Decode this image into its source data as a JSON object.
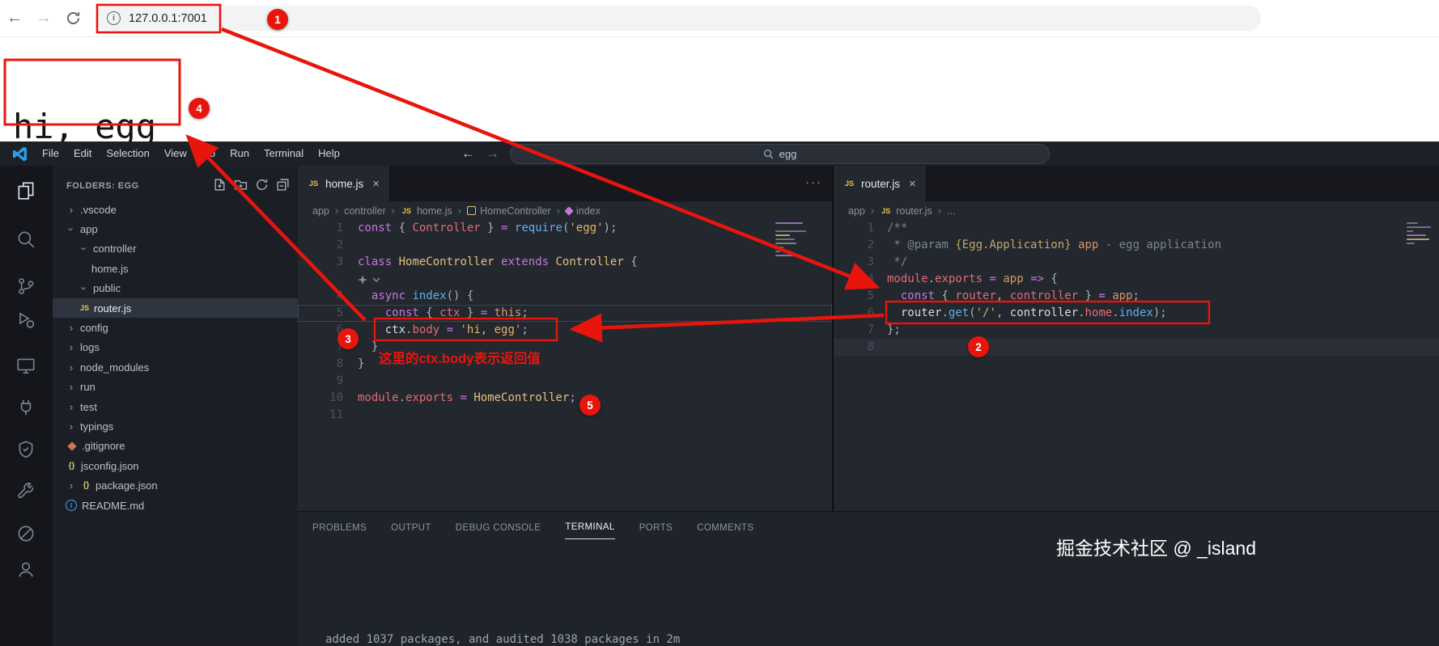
{
  "browser": {
    "url": "127.0.0.1:7001",
    "page_text": "hi, egg"
  },
  "icons": {
    "js_badge": "JS",
    "braces_badge": "{}"
  },
  "colors": {
    "annotation_red": "#e8150d",
    "js_icon_yellow": "#e3c74c",
    "info_blue": "#4aa0e8"
  },
  "vscode": {
    "title_menus": [
      "File",
      "Edit",
      "Selection",
      "View",
      "Go",
      "Run",
      "Terminal",
      "Help"
    ],
    "command_center": {
      "value": "egg"
    },
    "activity_icons": [
      "explorer",
      "search",
      "source-control",
      "run-debug",
      "remote-explorer",
      "ports",
      "shield",
      "tools",
      "circle-slash",
      "account"
    ],
    "sidebar": {
      "header": "FOLDERS: EGG",
      "actions": [
        "new-file",
        "new-folder",
        "refresh",
        "collapse-all"
      ],
      "items": [
        {
          "label": ".vscode",
          "chevron": "right",
          "indent": 0
        },
        {
          "label": "app",
          "chevron": "down",
          "indent": 0
        },
        {
          "label": "controller",
          "chevron": "down",
          "indent": 1
        },
        {
          "label": "home.js",
          "indent": 2
        },
        {
          "label": "public",
          "chevron": "down",
          "indent": 1
        },
        {
          "label": "router.js",
          "icon": "js",
          "indent": 1,
          "selected": true
        },
        {
          "label": "config",
          "chevron": "right",
          "indent": 0
        },
        {
          "label": "logs",
          "chevron": "right",
          "indent": 0
        },
        {
          "label": "node_modules",
          "chevron": "right",
          "indent": 0
        },
        {
          "label": "run",
          "chevron": "right",
          "indent": 0
        },
        {
          "label": "test",
          "chevron": "right",
          "indent": 0
        },
        {
          "label": "typings",
          "chevron": "right",
          "indent": 0
        },
        {
          "label": ".gitignore",
          "icon": "git",
          "indent": 0
        },
        {
          "label": "jsconfig.json",
          "icon": "braces",
          "indent": 0
        },
        {
          "label": "package.json",
          "chevron": "right",
          "icon": "braces",
          "indent": 0
        },
        {
          "label": "README.md",
          "icon": "info",
          "indent": 0
        }
      ]
    },
    "editor_groups": [
      {
        "tab": {
          "label": "home.js",
          "icon": "js"
        },
        "breadcrumbs": [
          {
            "label": "app"
          },
          {
            "label": "controller"
          },
          {
            "label": "home.js",
            "icon": "js"
          },
          {
            "label": "HomeController",
            "icon": "class"
          },
          {
            "label": "index",
            "icon": "method"
          }
        ],
        "lines": [
          {
            "n": "1",
            "tokens": [
              [
                "kw",
                "const"
              ],
              [
                "pl",
                " { "
              ],
              [
                "vr",
                "Controller"
              ],
              [
                "pl",
                " } "
              ],
              [
                "kw",
                "="
              ],
              [
                "pl",
                " "
              ],
              [
                "fn",
                "require"
              ],
              [
                "pl",
                "("
              ],
              [
                "st",
                "'egg'"
              ],
              [
                "pl",
                ");"
              ]
            ]
          },
          {
            "n": "2",
            "tokens": []
          },
          {
            "n": "3",
            "tokens": [
              [
                "kw",
                "class"
              ],
              [
                "pl",
                " "
              ],
              [
                "cl",
                "HomeController"
              ],
              [
                "pl",
                " "
              ],
              [
                "kw",
                "extends"
              ],
              [
                "pl",
                " "
              ],
              [
                "cl",
                "Controller"
              ],
              [
                "pl",
                " {"
              ]
            ]
          },
          {
            "codelens": true
          },
          {
            "n": "4",
            "tokens": [
              [
                "pl",
                "  "
              ],
              [
                "kw",
                "async"
              ],
              [
                "pl",
                " "
              ],
              [
                "fn",
                "index"
              ],
              [
                "pl",
                "() {"
              ]
            ]
          },
          {
            "n": "5",
            "cur": true,
            "tokens": [
              [
                "pl",
                "    "
              ],
              [
                "kw",
                "const"
              ],
              [
                "pl",
                " { "
              ],
              [
                "vr",
                "ctx"
              ],
              [
                "pl",
                " } "
              ],
              [
                "kw",
                "="
              ],
              [
                "pl",
                " "
              ],
              [
                "nm",
                "this"
              ],
              [
                "pl",
                ";"
              ]
            ]
          },
          {
            "n": "6",
            "tokens": [
              [
                "pl",
                "    "
              ],
              [
                "wt",
                "ctx"
              ],
              [
                "pl",
                "."
              ],
              [
                "vr",
                "body"
              ],
              [
                "pl",
                " "
              ],
              [
                "kw",
                "="
              ],
              [
                "pl",
                " "
              ],
              [
                "st",
                "'hi, egg'"
              ],
              [
                "pl",
                ";"
              ]
            ]
          },
          {
            "n": "7",
            "tokens": [
              [
                "pl",
                "  }"
              ]
            ]
          },
          {
            "n": "8",
            "tokens": [
              [
                "pl",
                "}"
              ]
            ]
          },
          {
            "n": "9",
            "tokens": []
          },
          {
            "n": "10",
            "tokens": [
              [
                "vr",
                "module"
              ],
              [
                "pl",
                "."
              ],
              [
                "vr",
                "exports"
              ],
              [
                "pl",
                " "
              ],
              [
                "kw",
                "="
              ],
              [
                "pl",
                " "
              ],
              [
                "cl",
                "HomeController"
              ],
              [
                "pl",
                ";"
              ]
            ]
          },
          {
            "n": "11",
            "tokens": []
          }
        ]
      },
      {
        "tab": {
          "label": "router.js",
          "icon": "js"
        },
        "breadcrumbs": [
          {
            "label": "app"
          },
          {
            "label": "router.js",
            "icon": "js"
          },
          {
            "label": "..."
          }
        ],
        "lines": [
          {
            "n": "1",
            "tokens": [
              [
                "cm",
                "/**"
              ]
            ]
          },
          {
            "n": "2",
            "tokens": [
              [
                "cm",
                " * @param "
              ],
              [
                "ct",
                "{Egg.Application}"
              ],
              [
                "nm",
                " app"
              ],
              [
                "cm",
                " - egg application"
              ]
            ]
          },
          {
            "n": "3",
            "tokens": [
              [
                "cm",
                " */"
              ]
            ]
          },
          {
            "n": "4",
            "tokens": [
              [
                "vr",
                "module"
              ],
              [
                "pl",
                "."
              ],
              [
                "vr",
                "exports"
              ],
              [
                "pl",
                " "
              ],
              [
                "kw",
                "="
              ],
              [
                "pl",
                " "
              ],
              [
                "nm",
                "app"
              ],
              [
                "pl",
                " "
              ],
              [
                "kw",
                "=>"
              ],
              [
                "pl",
                " {"
              ]
            ]
          },
          {
            "n": "5",
            "tokens": [
              [
                "pl",
                "  "
              ],
              [
                "kw",
                "const"
              ],
              [
                "pl",
                " { "
              ],
              [
                "vr",
                "router"
              ],
              [
                "pl",
                ", "
              ],
              [
                "vr",
                "controller"
              ],
              [
                "pl",
                " } "
              ],
              [
                "kw",
                "="
              ],
              [
                "pl",
                " "
              ],
              [
                "nm",
                "app"
              ],
              [
                "pl",
                ";"
              ]
            ]
          },
          {
            "n": "6",
            "tokens": [
              [
                "pl",
                "  "
              ],
              [
                "wt",
                "router"
              ],
              [
                "pl",
                "."
              ],
              [
                "fn",
                "get"
              ],
              [
                "pl",
                "("
              ],
              [
                "st",
                "'/'"
              ],
              [
                "pl",
                ", "
              ],
              [
                "wt",
                "controller"
              ],
              [
                "pl",
                "."
              ],
              [
                "vr",
                "home"
              ],
              [
                "pl",
                "."
              ],
              [
                "fn",
                "index"
              ],
              [
                "pl",
                ");"
              ]
            ]
          },
          {
            "n": "7",
            "tokens": [
              [
                "pl",
                "};"
              ]
            ]
          },
          {
            "n": "8",
            "cur": true,
            "tokens": []
          }
        ]
      }
    ],
    "panel": {
      "tabs": [
        "PROBLEMS",
        "OUTPUT",
        "DEBUG CONSOLE",
        "TERMINAL",
        "PORTS",
        "COMMENTS"
      ],
      "active_tab": "TERMINAL",
      "terminal_line": "added 1037 packages, and audited 1038 packages in 2m"
    },
    "watermark": "掘金技术社区 @ _island"
  },
  "annotations": {
    "badges": [
      "1",
      "2",
      "3",
      "4",
      "5"
    ],
    "note": "这里的ctx.body表示返回值"
  }
}
